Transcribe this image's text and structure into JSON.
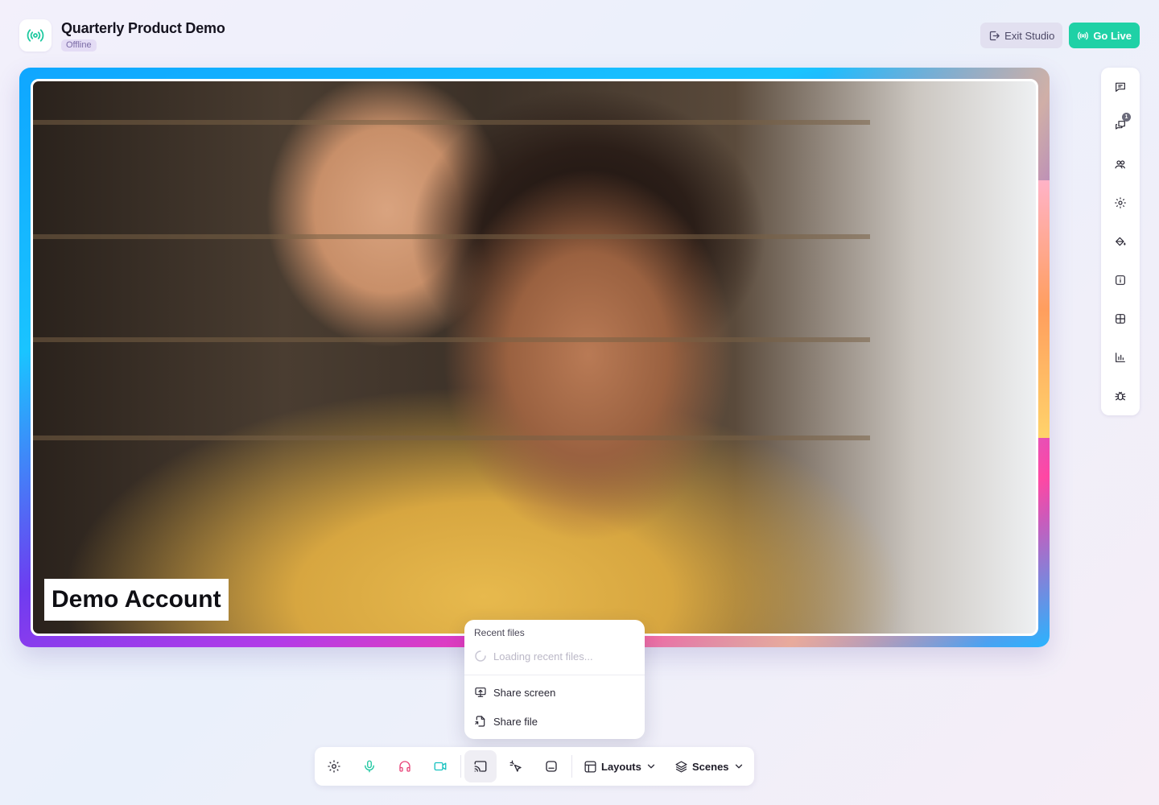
{
  "header": {
    "title": "Quarterly Product Demo",
    "status": "Offline",
    "exit_label": "Exit Studio",
    "live_label": "Go Live"
  },
  "stage": {
    "participant_name": "Demo Account"
  },
  "rail": {
    "items": [
      {
        "name": "chat-icon"
      },
      {
        "name": "comments-icon",
        "badge": "1"
      },
      {
        "name": "people-icon"
      },
      {
        "name": "settings-icon"
      },
      {
        "name": "paint-bucket-icon"
      },
      {
        "name": "info-icon"
      },
      {
        "name": "grid-icon"
      },
      {
        "name": "analytics-icon"
      },
      {
        "name": "bug-icon"
      }
    ]
  },
  "popup": {
    "heading": "Recent files",
    "loading": "Loading recent files...",
    "share_screen": "Share screen",
    "share_file": "Share file"
  },
  "toolbar": {
    "layouts_label": "Layouts",
    "scenes_label": "Scenes"
  },
  "colors": {
    "accent_green": "#1fd1a6",
    "mic_green": "#1cc7a0",
    "headphones_pink": "#e8457a",
    "camera_teal": "#19c2c0"
  }
}
